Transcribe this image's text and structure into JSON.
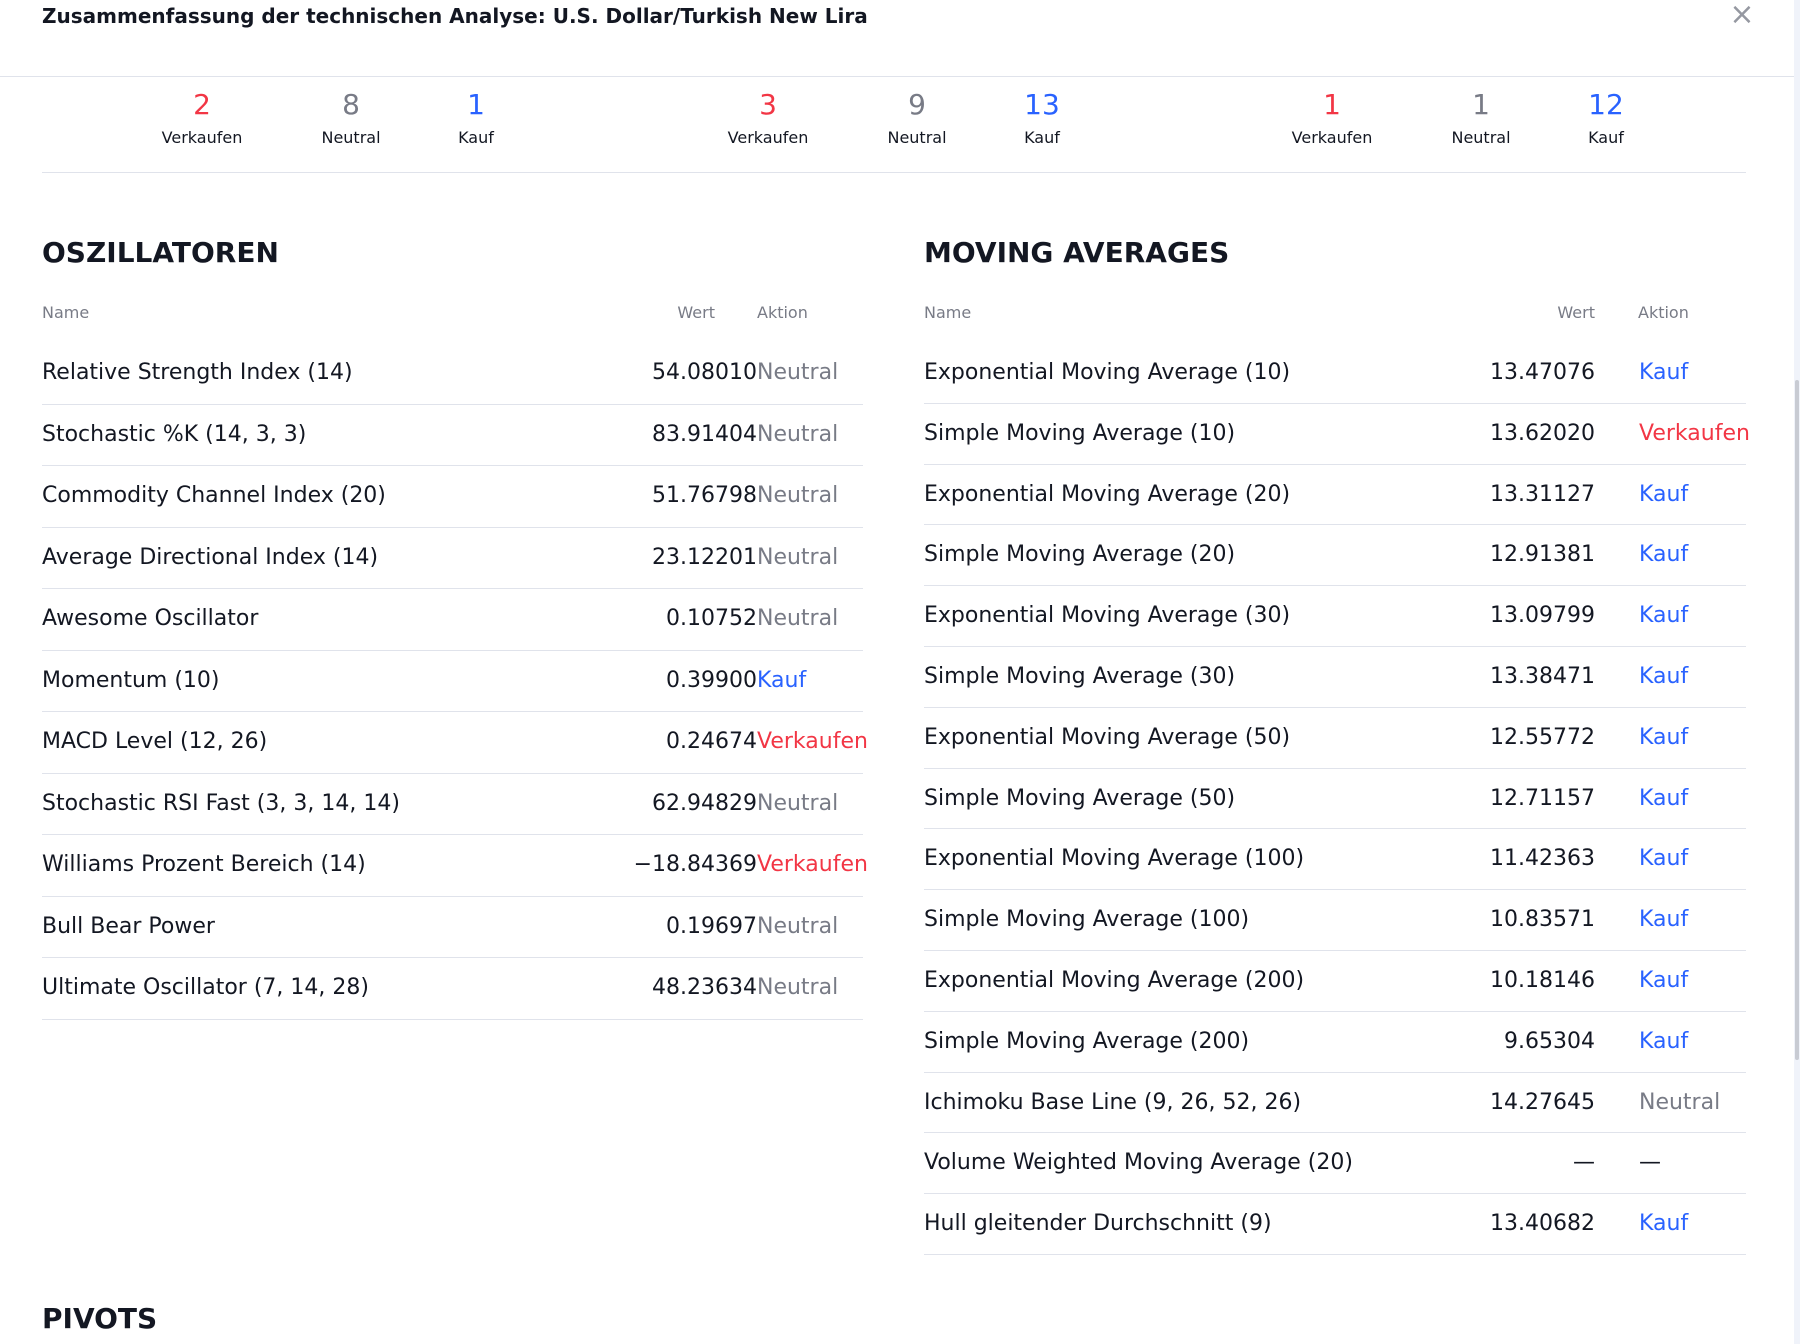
{
  "dialog": {
    "title": "Zusammenfassung der technischen Analyse: U.S. Dollar/Turkish New Lira",
    "close_label": "×"
  },
  "summary": {
    "groups": [
      {
        "sell": "2",
        "neutral": "8",
        "buy": "1"
      },
      {
        "sell": "3",
        "neutral": "9",
        "buy": "13"
      },
      {
        "sell": "1",
        "neutral": "1",
        "buy": "12"
      }
    ],
    "labels": {
      "sell": "Verkaufen",
      "neutral": "Neutral",
      "buy": "Kauf"
    }
  },
  "oscillators": {
    "title": "OSZILLATOREN",
    "headers": {
      "name": "Name",
      "value": "Wert",
      "action": "Aktion"
    },
    "rows": [
      {
        "name": "Relative Strength Index (14)",
        "value": "54.08010",
        "action": "Neutral",
        "type": "neutral"
      },
      {
        "name": "Stochastic %K (14, 3, 3)",
        "value": "83.91404",
        "action": "Neutral",
        "type": "neutral"
      },
      {
        "name": "Commodity Channel Index (20)",
        "value": "51.76798",
        "action": "Neutral",
        "type": "neutral"
      },
      {
        "name": "Average Directional Index (14)",
        "value": "23.12201",
        "action": "Neutral",
        "type": "neutral"
      },
      {
        "name": "Awesome Oscillator",
        "value": "0.10752",
        "action": "Neutral",
        "type": "neutral"
      },
      {
        "name": "Momentum (10)",
        "value": "0.39900",
        "action": "Kauf",
        "type": "buy"
      },
      {
        "name": "MACD Level (12, 26)",
        "value": "0.24674",
        "action": "Verkaufen",
        "type": "sell"
      },
      {
        "name": "Stochastic RSI Fast (3, 3, 14, 14)",
        "value": "62.94829",
        "action": "Neutral",
        "type": "neutral"
      },
      {
        "name": "Williams Prozent Bereich (14)",
        "value": "−18.84369",
        "action": "Verkaufen",
        "type": "sell"
      },
      {
        "name": "Bull Bear Power",
        "value": "0.19697",
        "action": "Neutral",
        "type": "neutral"
      },
      {
        "name": "Ultimate Oscillator (7, 14, 28)",
        "value": "48.23634",
        "action": "Neutral",
        "type": "neutral"
      }
    ]
  },
  "moving_averages": {
    "title": "MOVING AVERAGES",
    "headers": {
      "name": "Name",
      "value": "Wert",
      "action": "Aktion"
    },
    "rows": [
      {
        "name": "Exponential Moving Average (10)",
        "value": "13.47076",
        "action": "Kauf",
        "type": "buy"
      },
      {
        "name": "Simple Moving Average (10)",
        "value": "13.62020",
        "action": "Verkaufen",
        "type": "sell"
      },
      {
        "name": "Exponential Moving Average (20)",
        "value": "13.31127",
        "action": "Kauf",
        "type": "buy"
      },
      {
        "name": "Simple Moving Average (20)",
        "value": "12.91381",
        "action": "Kauf",
        "type": "buy"
      },
      {
        "name": "Exponential Moving Average (30)",
        "value": "13.09799",
        "action": "Kauf",
        "type": "buy"
      },
      {
        "name": "Simple Moving Average (30)",
        "value": "13.38471",
        "action": "Kauf",
        "type": "buy"
      },
      {
        "name": "Exponential Moving Average (50)",
        "value": "12.55772",
        "action": "Kauf",
        "type": "buy"
      },
      {
        "name": "Simple Moving Average (50)",
        "value": "12.71157",
        "action": "Kauf",
        "type": "buy"
      },
      {
        "name": "Exponential Moving Average (100)",
        "value": "11.42363",
        "action": "Kauf",
        "type": "buy"
      },
      {
        "name": "Simple Moving Average (100)",
        "value": "10.83571",
        "action": "Kauf",
        "type": "buy"
      },
      {
        "name": "Exponential Moving Average (200)",
        "value": "10.18146",
        "action": "Kauf",
        "type": "buy"
      },
      {
        "name": "Simple Moving Average (200)",
        "value": "9.65304",
        "action": "Kauf",
        "type": "buy"
      },
      {
        "name": "Ichimoku Base Line (9, 26, 52, 26)",
        "value": "14.27645",
        "action": "Neutral",
        "type": "neutral"
      },
      {
        "name": "Volume Weighted Moving Average (20)",
        "value": "—",
        "action": "—",
        "type": "none"
      },
      {
        "name": "Hull gleitender Durchschnitt (9)",
        "value": "13.40682",
        "action": "Kauf",
        "type": "buy"
      }
    ]
  },
  "pivots": {
    "title": "PIVOTS"
  },
  "colors": {
    "sell": "#f23645",
    "neutral": "#787b86",
    "buy": "#2962ff",
    "text": "#131722"
  }
}
